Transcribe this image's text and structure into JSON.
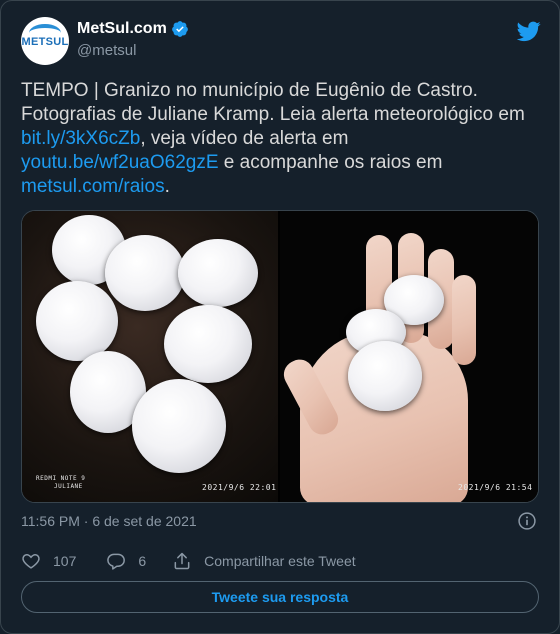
{
  "author": {
    "display_name": "MetSul.com",
    "handle": "@metsul",
    "avatar_text": "METSUL",
    "verified": true
  },
  "tweet": {
    "text_parts": [
      "TEMPO | Granizo no município de Eugênio de Castro. Fotografias de Juliane Kramp. Leia alerta meteorológico em ",
      "bit.ly/3kX6cZb",
      ", veja vídeo de alerta em ",
      "youtu.be/wf2uaO62gzE",
      " e acompanhe os raios em ",
      "metsul.com/raios",
      "."
    ],
    "timestamp": "11:56 PM · 6 de set de 2021"
  },
  "media": {
    "left_stamp_device": "REDMI NOTE 9",
    "left_stamp_author": "JULIANE",
    "left_stamp_datetime": "2021/9/6  22:01",
    "right_stamp_datetime": "2021/9/6  21:54"
  },
  "actions": {
    "likes": "107",
    "replies": "6",
    "share_label": "Compartilhar este Tweet"
  },
  "reply_button": "Tweete sua resposta",
  "colors": {
    "background": "#15202b",
    "accent": "#1d9bf0",
    "secondary_text": "#8b98a5",
    "border": "#38444d"
  },
  "icons": [
    "verified-badge-icon",
    "twitter-bird-icon",
    "info-icon",
    "heart-icon",
    "reply-icon",
    "share-icon"
  ]
}
